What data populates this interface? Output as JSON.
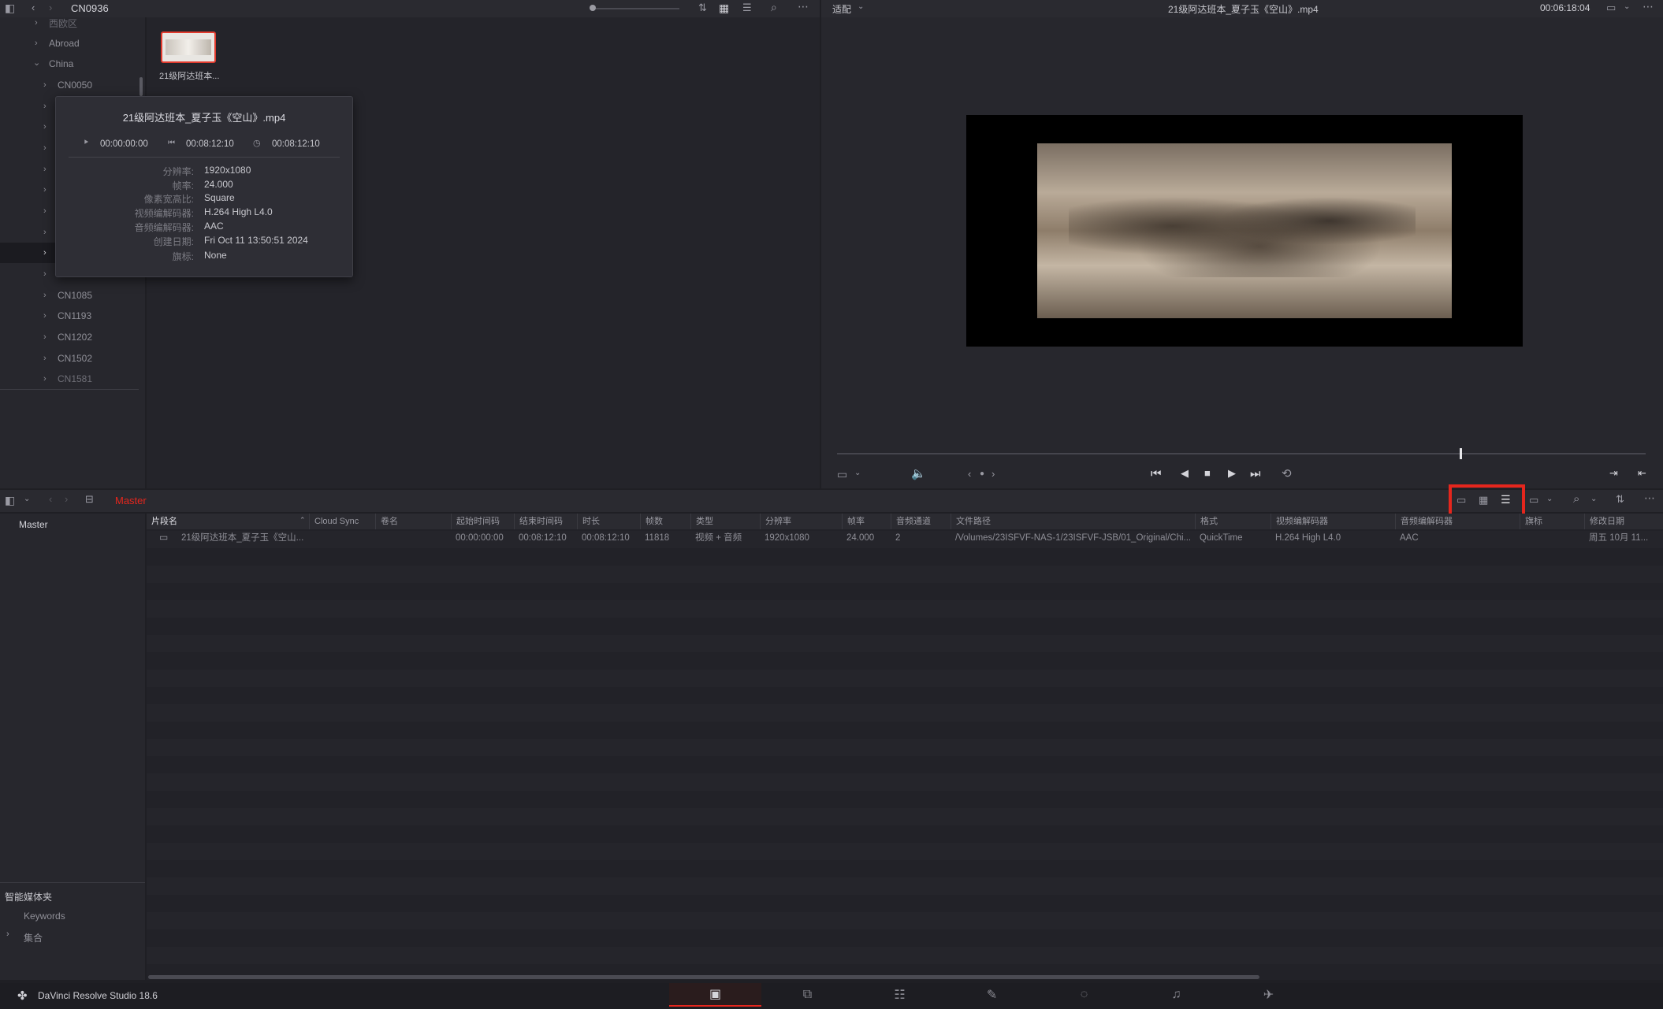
{
  "media_pool_top": {
    "folder_title": "CN0936"
  },
  "viewer_top": {
    "fit_label": "适配",
    "clip_title": "21级阿达班本_夏子玉《空山》.mp4",
    "timecode": "00:06:18:04"
  },
  "tree": {
    "top_partial": "西欧区",
    "items": [
      {
        "label": "Abroad",
        "expanded": false
      },
      {
        "label": "China",
        "expanded": true
      },
      {
        "label": "CN0050"
      },
      {
        "label": ""
      },
      {
        "label": ""
      },
      {
        "label": ""
      },
      {
        "label": ""
      },
      {
        "label": ""
      },
      {
        "label": ""
      },
      {
        "label": ""
      },
      {
        "label": ""
      },
      {
        "label": "CN0987"
      },
      {
        "label": "CN1085"
      },
      {
        "label": "CN1193"
      },
      {
        "label": "CN1202"
      },
      {
        "label": "CN1502"
      },
      {
        "label": "CN1581"
      }
    ]
  },
  "thumbnail": {
    "label": "21级阿达班本..."
  },
  "popup": {
    "title": "21级阿达班本_夏子玉《空山》.mp4",
    "tc_start": "00:00:00:00",
    "tc_end": "00:08:12:10",
    "tc_duration": "00:08:12:10",
    "fields": [
      {
        "k": "分辨率:",
        "v": "1920x1080"
      },
      {
        "k": "帧率:",
        "v": "24.000"
      },
      {
        "k": "像素宽高比:",
        "v": "Square"
      },
      {
        "k": "视频编解码器:",
        "v": "H.264 High L4.0"
      },
      {
        "k": "音频编解码器:",
        "v": "AAC"
      },
      {
        "k": "创建日期:",
        "v": "Fri Oct 11 13:50:51 2024"
      },
      {
        "k": "旗标:",
        "v": "None"
      }
    ]
  },
  "scrubber": {
    "progress_fraction": 0.77
  },
  "bin_bar": {
    "bin_name": "Master",
    "sidebar_master": "Master",
    "highlight_color": "#e5261d"
  },
  "table": {
    "headers": [
      "片段名",
      "Cloud Sync",
      "卷名",
      "起始时间码",
      "结束时间码",
      "时长",
      "帧数",
      "类型",
      "分辨率",
      "帧率",
      "音频通道",
      "文件路径",
      "格式",
      "视频编解码器",
      "音频编解码器",
      "旗标",
      "修改日期"
    ],
    "rows": [
      [
        "21级阿达班本_夏子玉《空山...",
        "",
        "",
        "00:00:00:00",
        "00:08:12:10",
        "00:08:12:10",
        "11818",
        "视频 + 音频",
        "1920x1080",
        "24.000",
        "2",
        "/Volumes/23ISFVF-NAS-1/23ISFVF-JSB/01_Original/Chi...",
        "QuickTime",
        "H.264 High L4.0",
        "AAC",
        "",
        "周五 10月 11..."
      ]
    ]
  },
  "smart_bins": {
    "title": "智能媒体夹",
    "keywords": "Keywords",
    "collections": "集合"
  },
  "footer": {
    "app_name": "DaVinci Resolve Studio 18.6"
  }
}
